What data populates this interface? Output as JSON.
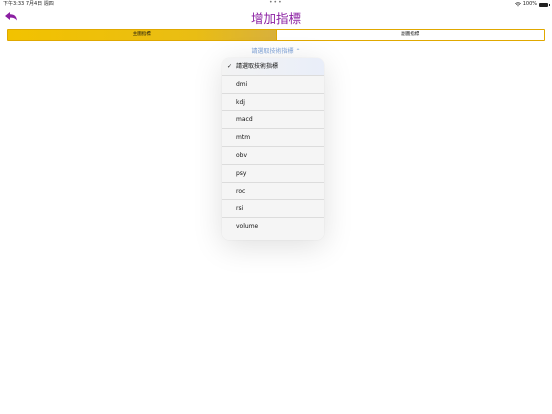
{
  "status_bar": {
    "time_date": "下午3:33  7月4日 週四",
    "dots": "•••",
    "battery": "100%"
  },
  "header": {
    "title": "增加指標"
  },
  "segmented": {
    "primary": "主圖指標",
    "secondary": "副圖指標"
  },
  "selector": {
    "label": "請選取技術指標 ⌃"
  },
  "menu": {
    "items": [
      {
        "label": "請選取技術指標"
      },
      {
        "label": "dmi"
      },
      {
        "label": "kdj"
      },
      {
        "label": "macd"
      },
      {
        "label": "mtm"
      },
      {
        "label": "obv"
      },
      {
        "label": "psy"
      },
      {
        "label": "roc"
      },
      {
        "label": "rsi"
      },
      {
        "label": "volume"
      }
    ],
    "checkmark": "✓"
  },
  "colors": {
    "title": "#8b1fa2",
    "accent": "#f2c200",
    "link": "#7ea2d8"
  }
}
